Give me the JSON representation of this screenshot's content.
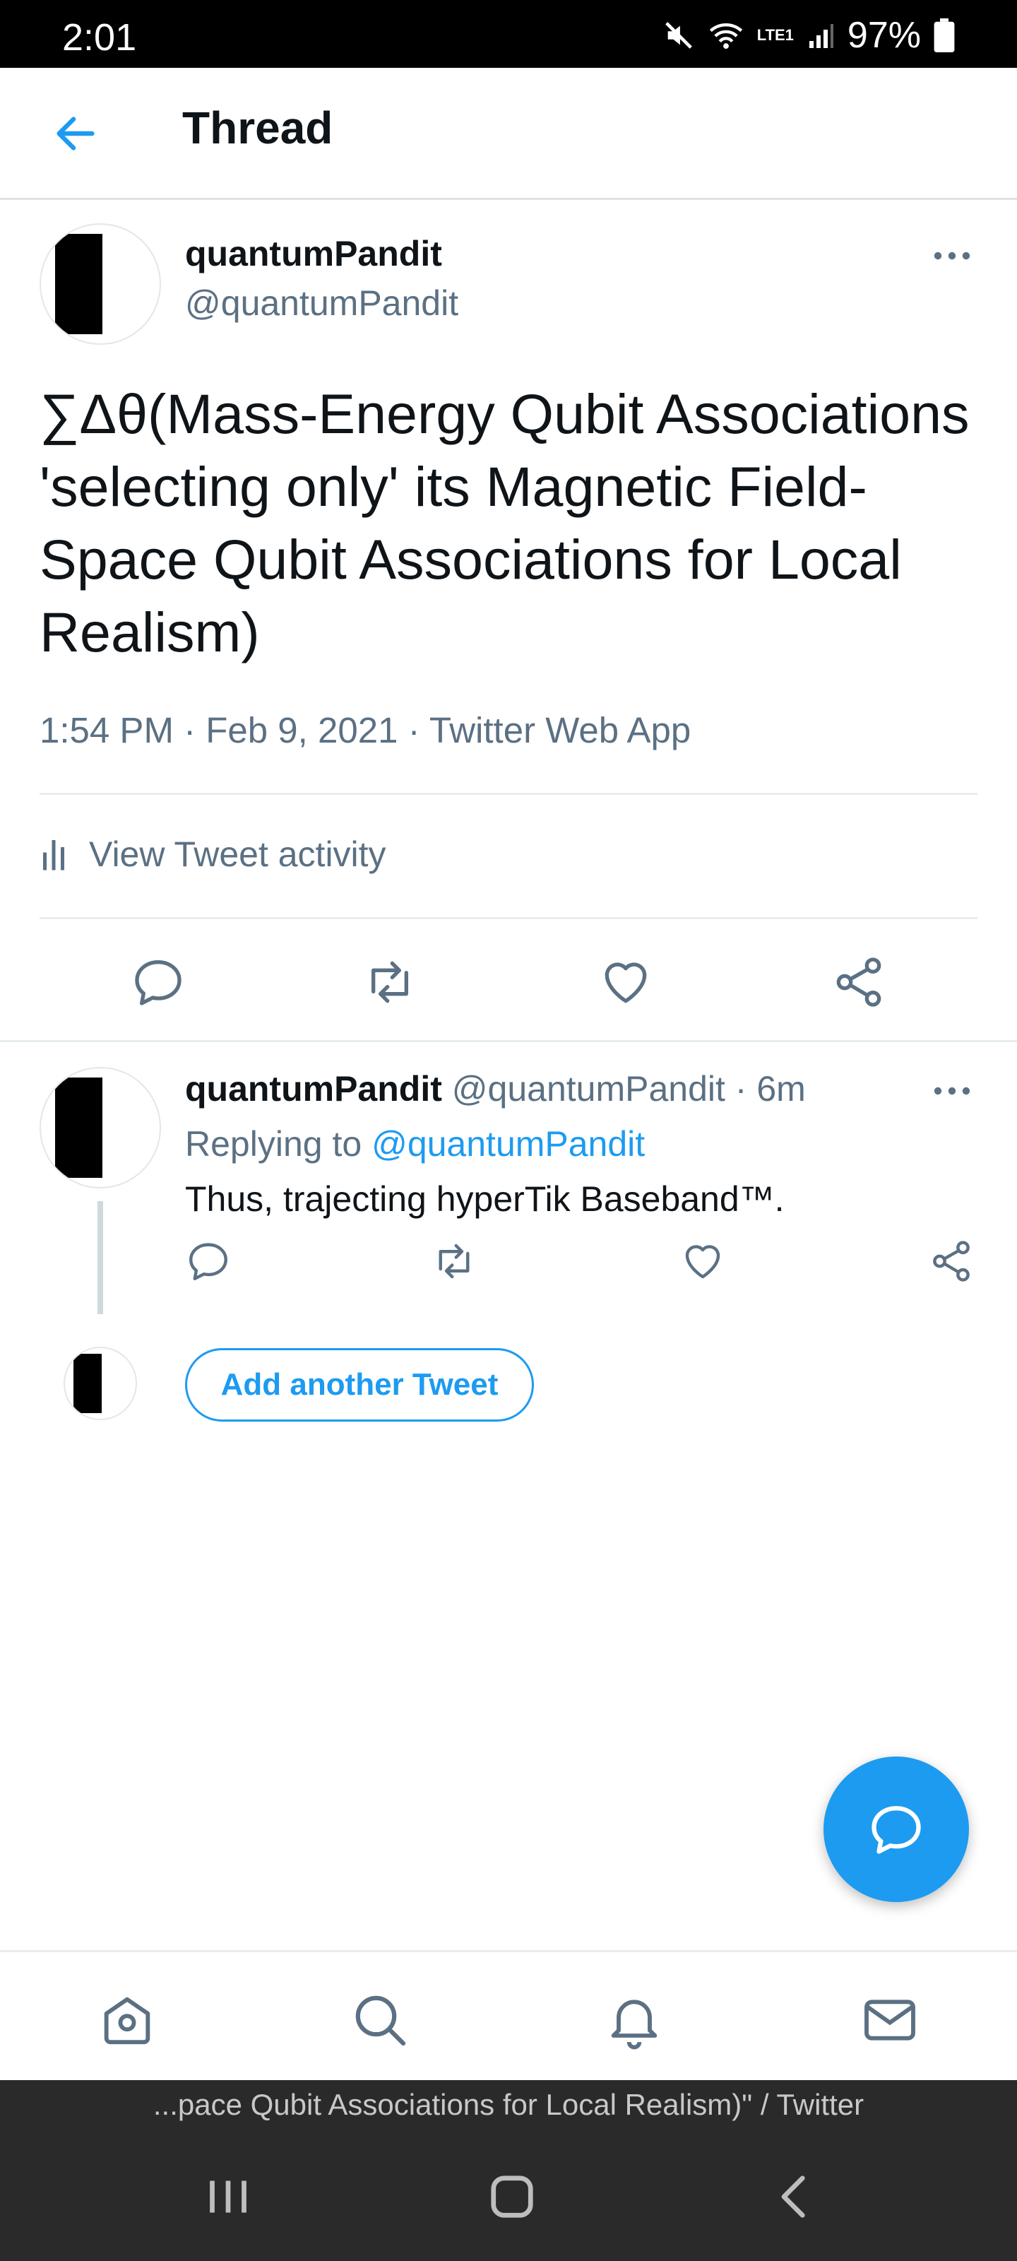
{
  "status_bar": {
    "time": "2:01",
    "network_label": "LTE1",
    "battery": "97%"
  },
  "header": {
    "title": "Thread"
  },
  "main_tweet": {
    "display_name": "quantumPandit",
    "handle": "@quantumPandit",
    "text": "∑Δθ(Mass-Energy Qubit Associations 'selecting only' its Magnetic Field-Space Qubit Associations for Local Realism)",
    "timestamp": "1:54 PM · Feb 9, 2021 · Twitter Web App",
    "activity_label": "View Tweet activity"
  },
  "reply_tweet": {
    "display_name": "quantumPandit",
    "handle": "@quantumPandit",
    "separator": "·",
    "time": "6m",
    "replying_prefix": "Replying to",
    "replying_handle": "@quantumPandit",
    "text": "Thus, trajecting hyperTik Baseband™."
  },
  "compose": {
    "add_tweet_label": "Add another Tweet"
  },
  "browser": {
    "page_title": "...pace Qubit Associations for Local Realism)\" / Twitter"
  },
  "icons": {
    "back": "arrow-left-icon",
    "more": "more-horizontal-icon",
    "activity": "bar-chart-icon",
    "reply": "reply-icon",
    "retweet": "retweet-icon",
    "like": "heart-icon",
    "share": "share-icon",
    "compose": "compose-bubble-icon",
    "home": "home-icon",
    "search": "search-icon",
    "notifications": "bell-icon",
    "messages": "mail-icon"
  },
  "colors": {
    "accent": "#1d9bf0",
    "secondary_text": "#5b7083",
    "system_bar": "#000000",
    "nav_bar": "#2a2a2a"
  }
}
